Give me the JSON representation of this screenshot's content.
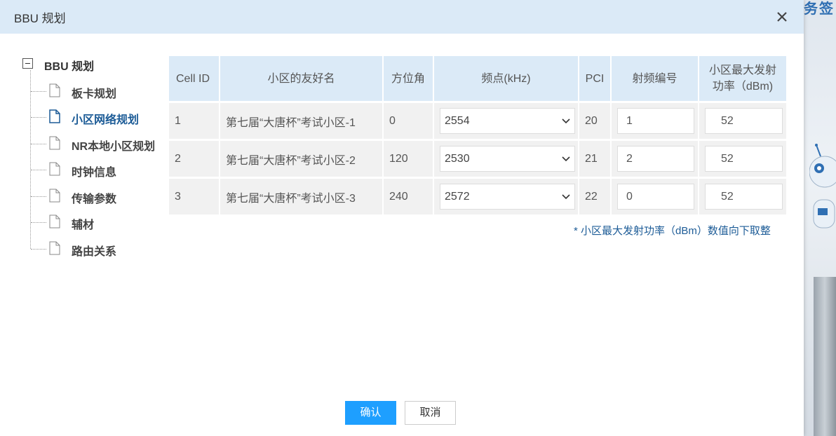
{
  "background": {
    "text": "务签"
  },
  "dialog": {
    "title": "BBU 规划",
    "close_icon": "close-icon",
    "tree": {
      "root_label": "BBU 规划",
      "items": [
        {
          "label": "板卡规划",
          "icon": "file-icon",
          "active": false
        },
        {
          "label": "小区网络规划",
          "icon": "file-icon",
          "active": true
        },
        {
          "label": "NR本地小区规划",
          "icon": "file-icon",
          "active": false
        },
        {
          "label": "时钟信息",
          "icon": "file-icon",
          "active": false
        },
        {
          "label": "传输参数",
          "icon": "file-icon",
          "active": false
        },
        {
          "label": "辅材",
          "icon": "file-icon",
          "active": false
        },
        {
          "label": "路由关系",
          "icon": "file-icon",
          "active": false
        }
      ]
    },
    "table": {
      "headers": {
        "cell_id": "Cell ID",
        "name": "小区的友好名",
        "azimuth": "方位角",
        "freq": "频点(kHz)",
        "pci": "PCI",
        "rf": "射频编号",
        "power_line1": "小区最大发射",
        "power_line2": "功率（dBm)"
      },
      "rows": [
        {
          "cell_id": "1",
          "name": "第七届“大唐杯”考试小区-1",
          "azimuth": "0",
          "freq": "2554",
          "pci": "20",
          "rf": "1",
          "power": "52"
        },
        {
          "cell_id": "2",
          "name": "第七届“大唐杯”考试小区-2",
          "azimuth": "120",
          "freq": "2530",
          "pci": "21",
          "rf": "2",
          "power": "52"
        },
        {
          "cell_id": "3",
          "name": "第七届“大唐杯”考试小区-3",
          "azimuth": "240",
          "freq": "2572",
          "pci": "22",
          "rf": "0",
          "power": "52"
        }
      ]
    },
    "note": "* 小区最大发射功率（dBm）数值向下取整",
    "buttons": {
      "confirm": "确认",
      "cancel": "取消"
    },
    "colors": {
      "header_bg": "#dbeaf7",
      "primary": "#1e9fff",
      "active_text": "#1d5c97"
    }
  }
}
